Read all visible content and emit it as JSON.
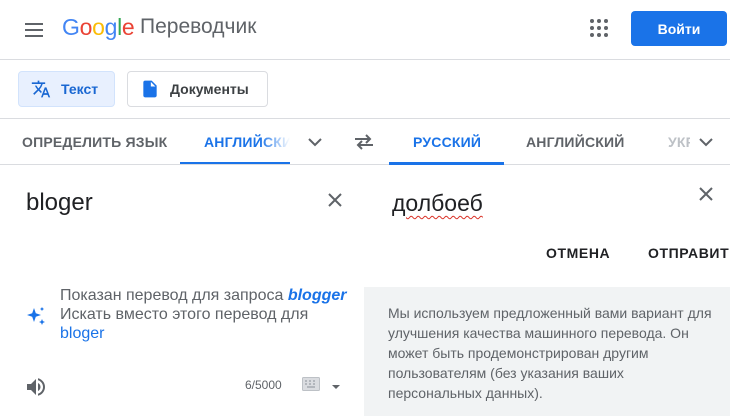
{
  "header": {
    "logo": [
      "G",
      "o",
      "o",
      "g",
      "l",
      "e"
    ],
    "logo_colors": [
      "#4285f4",
      "#ea4335",
      "#fbbc05",
      "#4285f4",
      "#34a853",
      "#ea4335"
    ],
    "product": "Переводчик",
    "login_label": "Войти",
    "menu_icon": "hamburger-menu-icon",
    "apps_icon": "apps-grid-icon"
  },
  "modes": {
    "text_label": "Текст",
    "docs_label": "Документы",
    "active": "text"
  },
  "languages": {
    "source": [
      "ОПРЕДЕЛИТЬ ЯЗЫК",
      "АНГЛИЙСКИЙ"
    ],
    "source_active": "АНГЛИЙСКИЙ",
    "target": [
      "РУССКИЙ",
      "АНГЛИЙСКИЙ",
      "УКРАИНСКИЙ"
    ],
    "target_active": "РУССКИЙ"
  },
  "source_panel": {
    "text": "bloger",
    "suggestion_prefix": "Показан перевод для запроса",
    "suggestion_word": "blogger",
    "alt_prefix": "Искать вместо этого перевод для",
    "alt_word": "bloger",
    "char_count": "6/5000"
  },
  "target_panel": {
    "edited_translation": "долбоеб",
    "cancel_label": "ОТМЕНА",
    "send_label": "ОТПРАВИТЬ",
    "notice": "Мы используем предложенный вами вариант для улучшения качества машинного перевода. Он может быть продемонстрирован другим пользователям (без указания ваших персональных данных)."
  },
  "colors": {
    "accent": "#1a73e8",
    "active_mode_bg": "#e8f0fe",
    "panel_bg": "#f1f3f4",
    "spellcheck": "#d93025"
  }
}
